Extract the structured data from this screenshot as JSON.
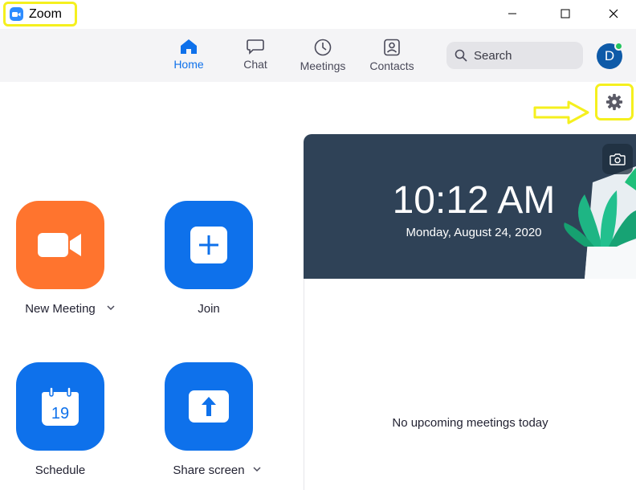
{
  "window": {
    "title": "Zoom",
    "controls": {
      "minimize": "minimize-icon",
      "maximize": "maximize-icon",
      "close": "close-icon"
    }
  },
  "nav": {
    "items": [
      {
        "label": "Home",
        "icon": "home-icon",
        "active": true
      },
      {
        "label": "Chat",
        "icon": "chat-icon",
        "active": false
      },
      {
        "label": "Meetings",
        "icon": "clock-icon",
        "active": false
      },
      {
        "label": "Contacts",
        "icon": "contacts-icon",
        "active": false
      }
    ],
    "search_label": "Search",
    "avatar_initial": "D",
    "avatar_status_color": "#22c55e"
  },
  "actions": [
    {
      "label": "New Meeting",
      "icon": "video-camera-icon",
      "color": "#ff742e",
      "has_dropdown": true
    },
    {
      "label": "Join",
      "icon": "plus-icon",
      "color": "#0e71eb",
      "has_dropdown": false
    },
    {
      "label": "Schedule",
      "icon": "calendar-icon",
      "icon_text": "19",
      "color": "#0e71eb",
      "has_dropdown": false
    },
    {
      "label": "Share screen",
      "icon": "share-screen-icon",
      "color": "#0e71eb",
      "has_dropdown": true
    }
  ],
  "banner": {
    "time": "10:12 AM",
    "date": "Monday, August 24, 2020",
    "background_color": "#2f4257"
  },
  "meetings": {
    "empty_text": "No upcoming meetings today"
  },
  "colors": {
    "accent": "#0e71eb",
    "highlight": "#f5f01e"
  }
}
